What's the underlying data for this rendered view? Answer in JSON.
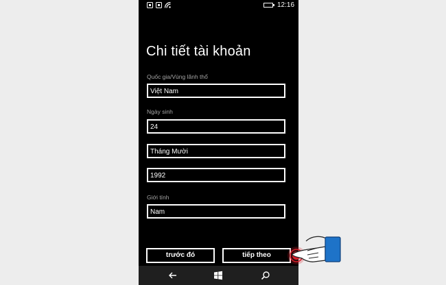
{
  "status_bar": {
    "icons": [
      "sim1-signal-icon",
      "sim2-signal-icon",
      "wifi-icon",
      "battery-icon"
    ],
    "time": "12:16"
  },
  "title": "Chi tiết tài khoản",
  "form": {
    "country_label": "Quốc gia/Vùng lãnh thổ",
    "country_value": "Việt Nam",
    "birthday_label": "Ngày sinh",
    "day_value": "24",
    "month_value": "Tháng Mười",
    "year_value": "1992",
    "gender_label": "Giới tính",
    "gender_value": "Nam"
  },
  "buttons": {
    "back_label": "trước đó",
    "next_label": "tiếp theo"
  },
  "nav_bar": {
    "icons": [
      "back-arrow-icon",
      "windows-start-icon",
      "search-icon"
    ]
  },
  "colors": {
    "screen_bg": "#000000",
    "page_bg": "#ededed",
    "label_gray": "#a6a6a6",
    "pointer_blue": "#1e73c8",
    "tap_red": "#d81e2a"
  }
}
